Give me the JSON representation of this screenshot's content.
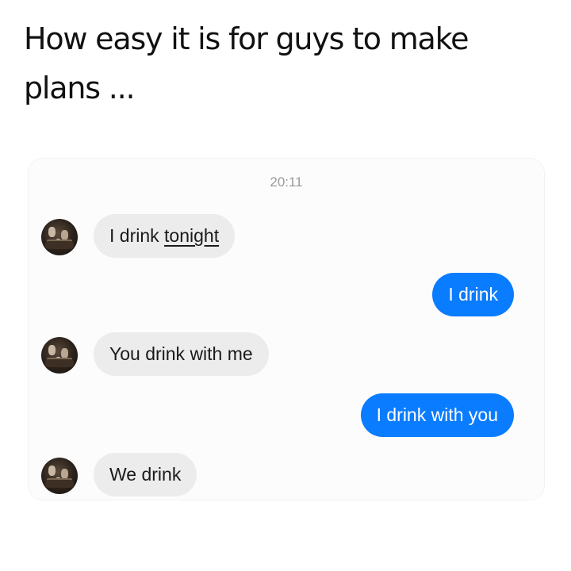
{
  "meme": {
    "title": "How easy it is for guys to make plans ..."
  },
  "chat": {
    "timestamp": "20:11",
    "messages": [
      {
        "direction": "incoming",
        "text_plain": "I drink ",
        "text_underlined": "tonight",
        "has_avatar": true
      },
      {
        "direction": "outgoing",
        "text": "I drink"
      },
      {
        "direction": "incoming",
        "text": "You drink with me",
        "has_avatar": true
      },
      {
        "direction": "outgoing",
        "text": "I drink with you"
      },
      {
        "direction": "incoming",
        "text": "We drink",
        "has_avatar": true
      }
    ]
  },
  "colors": {
    "incoming_bubble": "#ececec",
    "outgoing_bubble": "#0a7cff",
    "timestamp_text": "#9a9a9a"
  },
  "icons": {
    "avatar": "contact-photo"
  }
}
